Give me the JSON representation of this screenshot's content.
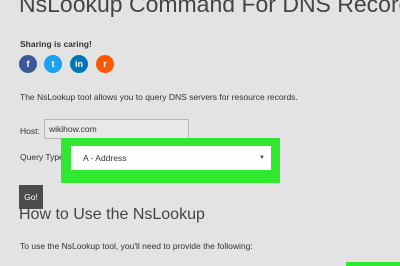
{
  "page": {
    "title": "NsLookup Command For DNS Records",
    "sharing_label": "Sharing is caring!",
    "social": [
      {
        "name": "facebook",
        "glyph": "f",
        "color": "#3b5998"
      },
      {
        "name": "twitter",
        "glyph": "t",
        "color": "#1da1f2"
      },
      {
        "name": "linkedin",
        "glyph": "in",
        "color": "#0077b5"
      },
      {
        "name": "reddit",
        "glyph": "r",
        "color": "#ff5700"
      }
    ],
    "description": "The NsLookup tool allows you to query DNS servers for resource records."
  },
  "form": {
    "host_label": "Host:",
    "host_value": "wikihow.com",
    "query_type_label": "Query Type",
    "query_type_value": "A - Address",
    "go_label": "Go!"
  },
  "section": {
    "heading": "How to Use the NsLookup",
    "text": "To use the NsLookup tool, you'll need to provide the following:"
  },
  "colors": {
    "highlight": "#2fe82f",
    "go_button": "#4c4c4c",
    "background": "#e3e3e3"
  }
}
